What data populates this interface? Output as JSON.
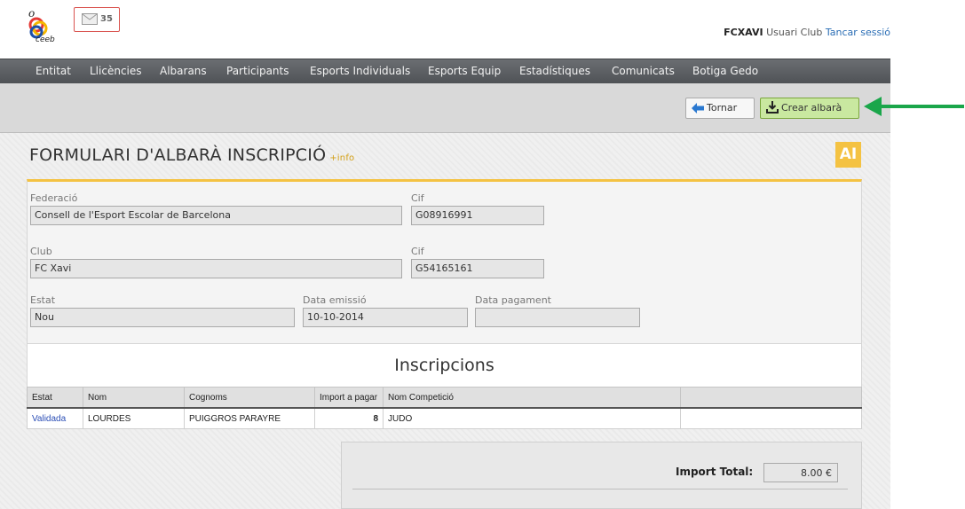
{
  "header": {
    "logo_text": "ceeb",
    "mail_count": "35",
    "user_name": "FCXAVI",
    "user_role": "Usuari Club",
    "logout_link": "Tancar sessió"
  },
  "nav": {
    "items": [
      "Entitat",
      "Llicències",
      "Albarans",
      "Participants",
      "Esports Individuals",
      "Esports Equip",
      "Estadístiques",
      "Comunicats",
      "Botiga Gedo"
    ]
  },
  "toolbar": {
    "back_label": "Tornar",
    "create_label": "Crear albarà"
  },
  "page": {
    "title": "FORMULARI D'ALBARÀ INSCRIPCIÓ",
    "info_link": "+info",
    "badge": "AI"
  },
  "form": {
    "federacio_label": "Federació",
    "federacio_value": "Consell de l'Esport Escolar de Barcelona",
    "cif1_label": "Cif",
    "cif1_value": "G08916991",
    "club_label": "Club",
    "club_value": "FC Xavi",
    "cif2_label": "Cif",
    "cif2_value": "G54165161",
    "estat_label": "Estat",
    "estat_value": "Nou",
    "data_emissio_label": "Data emissió",
    "data_emissio_value": "10-10-2014",
    "data_pagament_label": "Data pagament",
    "data_pagament_value": ""
  },
  "inscripcions": {
    "heading": "Inscripcions",
    "columns": [
      "Estat",
      "Nom",
      "Cognoms",
      "Import a pagar",
      "Nom Competició",
      ""
    ],
    "rows": [
      [
        "Validada",
        "LOURDES",
        "PUIGGROS PARAYRE",
        "8",
        "JUDO",
        ""
      ]
    ]
  },
  "total": {
    "label": "Import Total:",
    "value": "8.00 €"
  },
  "colors": {
    "nav_bg": "#5a5d61",
    "accent_yellow": "#f4c242",
    "create_btn": "#c9e8a0",
    "arrow_green": "#1aa64a",
    "link_blue": "#2a6db5"
  }
}
